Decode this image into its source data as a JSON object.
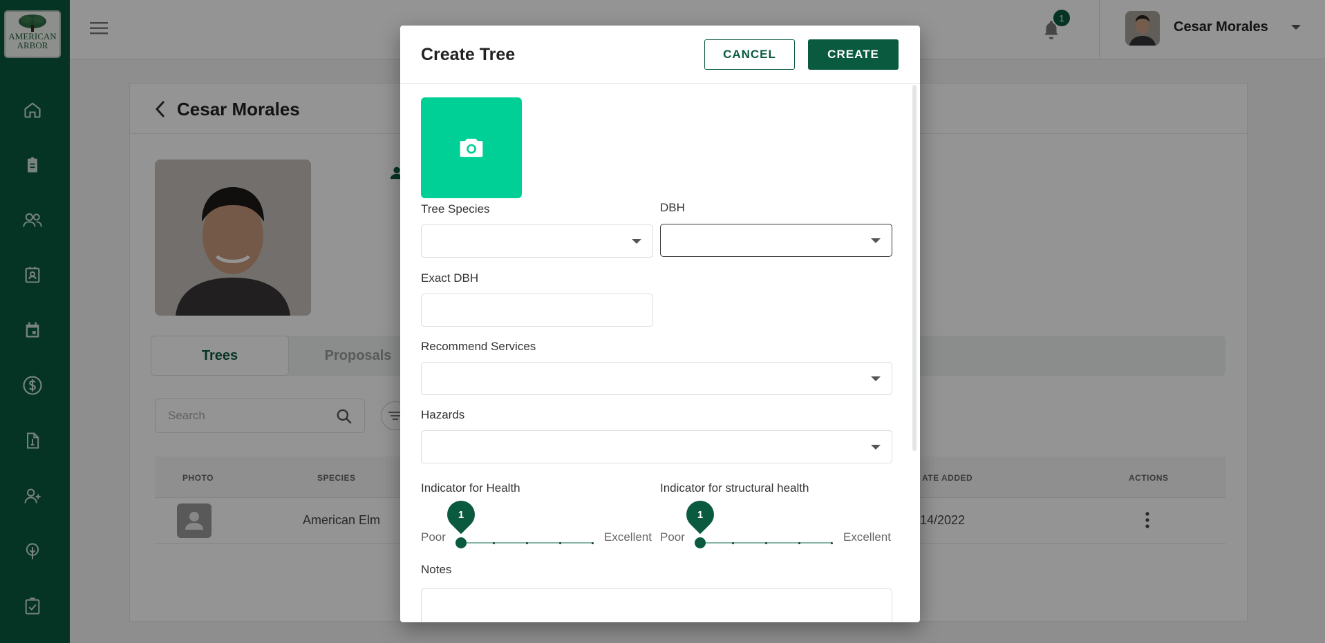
{
  "app": {
    "logo_line1": "AMERICAN",
    "logo_line2": "ARBOR"
  },
  "topbar": {
    "notification_count": "1",
    "user_name": "Cesar Morales"
  },
  "page": {
    "back_title": "Cesar Morales",
    "tabs": [
      {
        "label": "Trees"
      },
      {
        "label": "Proposals"
      }
    ],
    "search_placeholder": "Search",
    "table": {
      "headers": [
        "PHOTO",
        "SPECIES",
        "ATE ADDED",
        "ACTIONS"
      ],
      "rows": [
        {
          "species": "American Elm",
          "date_added": "/14/2022"
        }
      ]
    }
  },
  "modal": {
    "title": "Create Tree",
    "cancel_label": "CANCEL",
    "create_label": "CREATE",
    "fields": {
      "tree_species": {
        "label": "Tree Species",
        "value": ""
      },
      "dbh": {
        "label": "DBH",
        "value": ""
      },
      "exact_dbh": {
        "label": "Exact DBH",
        "value": ""
      },
      "recommend_services": {
        "label": "Recommend Services",
        "value": ""
      },
      "hazards": {
        "label": "Hazards",
        "value": ""
      },
      "notes": {
        "label": "Notes",
        "value": ""
      }
    },
    "health_slider": {
      "label": "Indicator for Health",
      "value": "1",
      "min_label": "Poor",
      "max_label": "Excellent"
    },
    "structural_slider": {
      "label": "Indicator for structural health",
      "value": "1",
      "min_label": "Poor",
      "max_label": "Excellent"
    }
  },
  "colors": {
    "brand_green": "#0a5a3f",
    "upload_green": "#00cf96"
  }
}
